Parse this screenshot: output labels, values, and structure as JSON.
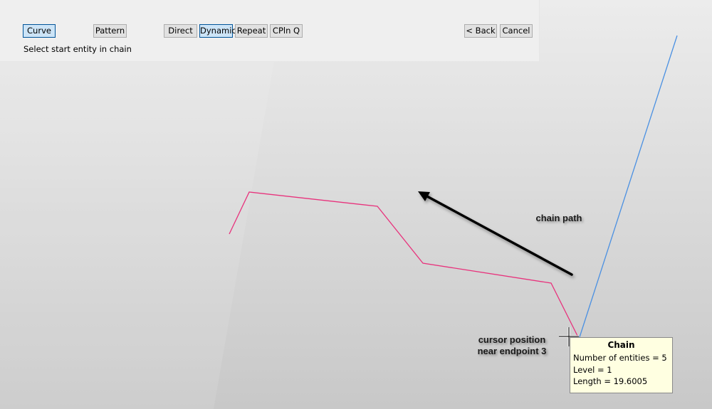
{
  "toolbar": {
    "mode_buttons": [
      {
        "label": "Curve",
        "active": true
      },
      {
        "label": "Pattern",
        "active": false
      }
    ],
    "option_buttons": [
      {
        "label": "Direct",
        "active": false
      },
      {
        "label": "Dynamic",
        "active": true
      },
      {
        "label": "Repeat",
        "active": false
      },
      {
        "label": "CPln Q",
        "active": false
      }
    ],
    "back_label": "< Back",
    "cancel_label": "Cancel",
    "prompt": "Select start entity in chain"
  },
  "viewport": {
    "chain_color": "#e8327c",
    "line_color": "#4a90e2",
    "annotations": {
      "chain_path": "chain path",
      "cursor_line1": "cursor position",
      "cursor_line2": "near endpoint 3"
    }
  },
  "tooltip": {
    "title": "Chain",
    "lines": [
      "Number of entities = 5",
      "Level = 1",
      "Length = 19.6005"
    ]
  }
}
